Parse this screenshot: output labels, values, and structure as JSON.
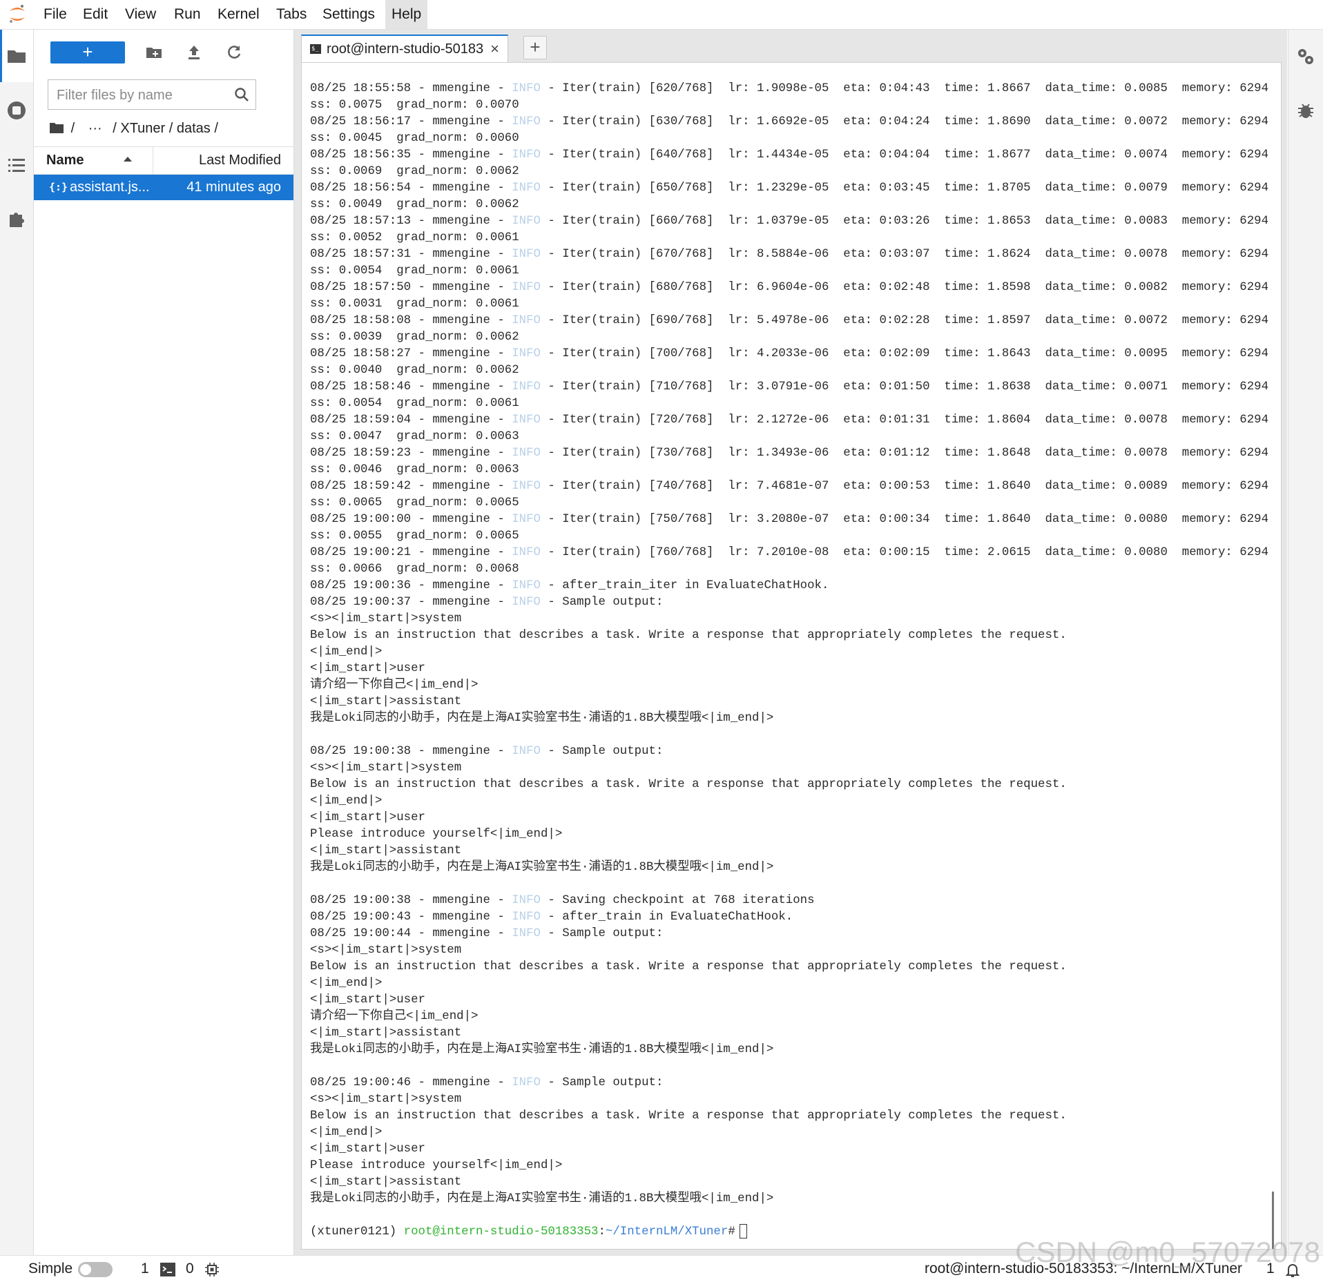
{
  "menu": [
    "File",
    "Edit",
    "View",
    "Run",
    "Kernel",
    "Tabs",
    "Settings",
    "Help"
  ],
  "filebrowser": {
    "new_label": "+",
    "filter_placeholder": "Filter files by name",
    "breadcrumb": {
      "root": "/",
      "ellipsis": "···",
      "path": "/ XTuner / datas /"
    },
    "col_name": "Name",
    "col_modified": "Last Modified",
    "files": [
      {
        "name": "assistant.js...",
        "modified": "41 minutes ago",
        "icon": "{:}"
      }
    ]
  },
  "tab": {
    "label": "root@intern-studio-50183",
    "close": "×",
    "add": "+"
  },
  "terminal": {
    "log": [
      {
        "p": "08/25 18:55:58 - mmengine - ",
        "i": "INFO",
        "r": " - Iter(train) [620/768]  lr: 1.9098e-05  eta: 0:04:43  time: 1.8667  data_time: 0.0085  memory: 6294  lo",
        "c": "ss: 0.0075  grad_norm: 0.0070"
      },
      {
        "p": "08/25 18:56:17 - mmengine - ",
        "i": "INFO",
        "r": " - Iter(train) [630/768]  lr: 1.6692e-05  eta: 0:04:24  time: 1.8690  data_time: 0.0072  memory: 6294  lo",
        "c": "ss: 0.0045  grad_norm: 0.0060"
      },
      {
        "p": "08/25 18:56:35 - mmengine - ",
        "i": "INFO",
        "r": " - Iter(train) [640/768]  lr: 1.4434e-05  eta: 0:04:04  time: 1.8677  data_time: 0.0074  memory: 6294  lo",
        "c": "ss: 0.0069  grad_norm: 0.0062"
      },
      {
        "p": "08/25 18:56:54 - mmengine - ",
        "i": "INFO",
        "r": " - Iter(train) [650/768]  lr: 1.2329e-05  eta: 0:03:45  time: 1.8705  data_time: 0.0079  memory: 6294  lo",
        "c": "ss: 0.0049  grad_norm: 0.0062"
      },
      {
        "p": "08/25 18:57:13 - mmengine - ",
        "i": "INFO",
        "r": " - Iter(train) [660/768]  lr: 1.0379e-05  eta: 0:03:26  time: 1.8653  data_time: 0.0083  memory: 6294  lo",
        "c": "ss: 0.0052  grad_norm: 0.0061"
      },
      {
        "p": "08/25 18:57:31 - mmengine - ",
        "i": "INFO",
        "r": " - Iter(train) [670/768]  lr: 8.5884e-06  eta: 0:03:07  time: 1.8624  data_time: 0.0078  memory: 6294  lo",
        "c": "ss: 0.0054  grad_norm: 0.0061"
      },
      {
        "p": "08/25 18:57:50 - mmengine - ",
        "i": "INFO",
        "r": " - Iter(train) [680/768]  lr: 6.9604e-06  eta: 0:02:48  time: 1.8598  data_time: 0.0082  memory: 6294  lo",
        "c": "ss: 0.0031  grad_norm: 0.0061"
      },
      {
        "p": "08/25 18:58:08 - mmengine - ",
        "i": "INFO",
        "r": " - Iter(train) [690/768]  lr: 5.4978e-06  eta: 0:02:28  time: 1.8597  data_time: 0.0072  memory: 6294  lo",
        "c": "ss: 0.0039  grad_norm: 0.0062"
      },
      {
        "p": "08/25 18:58:27 - mmengine - ",
        "i": "INFO",
        "r": " - Iter(train) [700/768]  lr: 4.2033e-06  eta: 0:02:09  time: 1.8643  data_time: 0.0095  memory: 6294  lo",
        "c": "ss: 0.0040  grad_norm: 0.0062"
      },
      {
        "p": "08/25 18:58:46 - mmengine - ",
        "i": "INFO",
        "r": " - Iter(train) [710/768]  lr: 3.0791e-06  eta: 0:01:50  time: 1.8638  data_time: 0.0071  memory: 6294  lo",
        "c": "ss: 0.0054  grad_norm: 0.0061"
      },
      {
        "p": "08/25 18:59:04 - mmengine - ",
        "i": "INFO",
        "r": " - Iter(train) [720/768]  lr: 2.1272e-06  eta: 0:01:31  time: 1.8604  data_time: 0.0078  memory: 6294  lo",
        "c": "ss: 0.0047  grad_norm: 0.0063"
      },
      {
        "p": "08/25 18:59:23 - mmengine - ",
        "i": "INFO",
        "r": " - Iter(train) [730/768]  lr: 1.3493e-06  eta: 0:01:12  time: 1.8648  data_time: 0.0078  memory: 6294  lo",
        "c": "ss: 0.0046  grad_norm: 0.0063"
      },
      {
        "p": "08/25 18:59:42 - mmengine - ",
        "i": "INFO",
        "r": " - Iter(train) [740/768]  lr: 7.4681e-07  eta: 0:00:53  time: 1.8640  data_time: 0.0089  memory: 6294  lo",
        "c": "ss: 0.0065  grad_norm: 0.0065"
      },
      {
        "p": "08/25 19:00:00 - mmengine - ",
        "i": "INFO",
        "r": " - Iter(train) [750/768]  lr: 3.2080e-07  eta: 0:00:34  time: 1.8640  data_time: 0.0080  memory: 6294  lo",
        "c": "ss: 0.0055  grad_norm: 0.0065"
      },
      {
        "p": "08/25 19:00:21 - mmengine - ",
        "i": "INFO",
        "r": " - Iter(train) [760/768]  lr: 7.2010e-08  eta: 0:00:15  time: 2.0615  data_time: 0.0080  memory: 6294  lo",
        "c": "ss: 0.0066  grad_norm: 0.0068"
      },
      {
        "p": "08/25 19:00:36 - mmengine - ",
        "i": "INFO",
        "r": " - after_train_iter in EvaluateChatHook."
      },
      {
        "p": "08/25 19:00:37 - mmengine - ",
        "i": "INFO",
        "r": " - Sample output:"
      },
      {
        "t": "<s><|im_start|>system"
      },
      {
        "t": "Below is an instruction that describes a task. Write a response that appropriately completes the request."
      },
      {
        "t": "<|im_end|>"
      },
      {
        "t": "<|im_start|>user"
      },
      {
        "t": "请介绍一下你自己<|im_end|>"
      },
      {
        "t": "<|im_start|>assistant"
      },
      {
        "t": "我是Loki同志的小助手，内在是上海AI实验室书生·浦语的1.8B大模型哦<|im_end|>"
      },
      {
        "t": ""
      },
      {
        "p": "08/25 19:00:38 - mmengine - ",
        "i": "INFO",
        "r": " - Sample output:"
      },
      {
        "t": "<s><|im_start|>system"
      },
      {
        "t": "Below is an instruction that describes a task. Write a response that appropriately completes the request."
      },
      {
        "t": "<|im_end|>"
      },
      {
        "t": "<|im_start|>user"
      },
      {
        "t": "Please introduce yourself<|im_end|>"
      },
      {
        "t": "<|im_start|>assistant"
      },
      {
        "t": "我是Loki同志的小助手，内在是上海AI实验室书生·浦语的1.8B大模型哦<|im_end|>"
      },
      {
        "t": ""
      },
      {
        "p": "08/25 19:00:38 - mmengine - ",
        "i": "INFO",
        "r": " - Saving checkpoint at 768 iterations"
      },
      {
        "p": "08/25 19:00:43 - mmengine - ",
        "i": "INFO",
        "r": " - after_train in EvaluateChatHook."
      },
      {
        "p": "08/25 19:00:44 - mmengine - ",
        "i": "INFO",
        "r": " - Sample output:"
      },
      {
        "t": "<s><|im_start|>system"
      },
      {
        "t": "Below is an instruction that describes a task. Write a response that appropriately completes the request."
      },
      {
        "t": "<|im_end|>"
      },
      {
        "t": "<|im_start|>user"
      },
      {
        "t": "请介绍一下你自己<|im_end|>"
      },
      {
        "t": "<|im_start|>assistant"
      },
      {
        "t": "我是Loki同志的小助手，内在是上海AI实验室书生·浦语的1.8B大模型哦<|im_end|>"
      },
      {
        "t": ""
      },
      {
        "p": "08/25 19:00:46 - mmengine - ",
        "i": "INFO",
        "r": " - Sample output:"
      },
      {
        "t": "<s><|im_start|>system"
      },
      {
        "t": "Below is an instruction that describes a task. Write a response that appropriately completes the request."
      },
      {
        "t": "<|im_end|>"
      },
      {
        "t": "<|im_start|>user"
      },
      {
        "t": "Please introduce yourself<|im_end|>"
      },
      {
        "t": "<|im_start|>assistant"
      },
      {
        "t": "我是Loki同志的小助手，内在是上海AI实验室书生·浦语的1.8B大模型哦<|im_end|>"
      },
      {
        "t": ""
      }
    ],
    "prompt": {
      "env": "(xtuner0121) ",
      "user": "root@intern-studio-50183353",
      "sep": ":",
      "path": "~/InternLM/XTuner",
      "end": "#"
    }
  },
  "statusbar": {
    "mode": "Simple",
    "terminals_count": "1",
    "kernels_count": "0",
    "path": "root@intern-studio-50183353: ~/InternLM/XTuner",
    "notifications": "1"
  },
  "watermark": "CSDN @m0_57072078",
  "colors": {
    "accent": "#1976d2",
    "info": "#b8d0e8",
    "prompt_user": "#32b332",
    "prompt_path": "#3d7fd6"
  }
}
